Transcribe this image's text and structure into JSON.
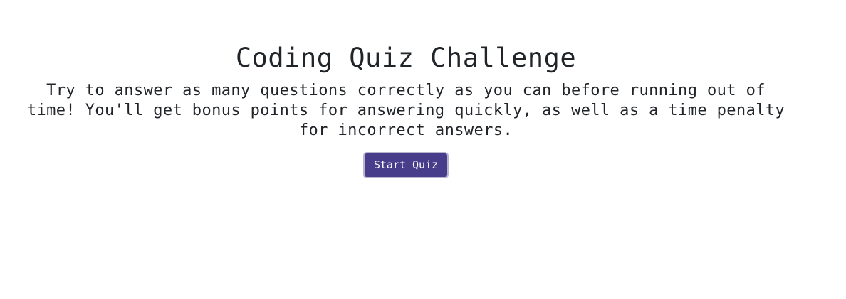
{
  "intro": {
    "title": "Coding Quiz Challenge",
    "description": "Try to answer as many questions correctly as you can before running out of time! You'll get bonus points for answering quickly, as well as a time penalty for incorrect answers.",
    "start_button_label": "Start Quiz"
  },
  "colors": {
    "text": "#212529",
    "button_background": "#483d8b",
    "button_text": "#ffffff",
    "button_border": "#b9b4cf",
    "page_background": "#ffffff"
  }
}
